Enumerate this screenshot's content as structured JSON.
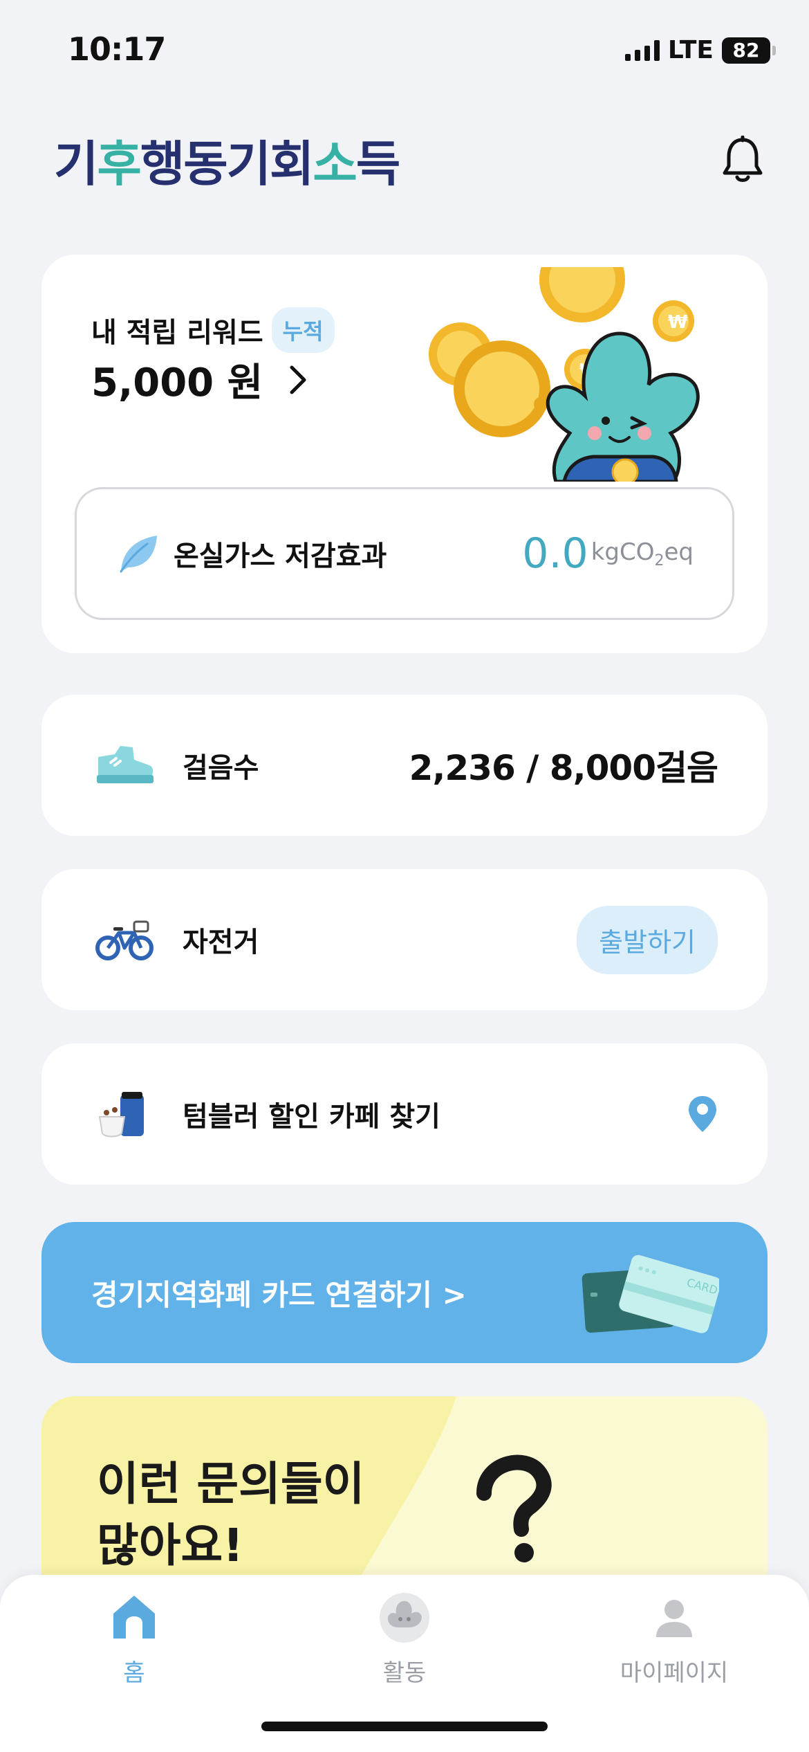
{
  "status_bar": {
    "time": "10:17",
    "network": "LTE",
    "battery": "82"
  },
  "header": {
    "logo_parts": [
      "기",
      "후",
      "행동기회",
      "소",
      "득"
    ]
  },
  "reward": {
    "label": "내 적립 리워드",
    "badge": "누적",
    "amount": "5,000 원",
    "ghg_label": "온실가스 저감효과",
    "ghg_value": "0.0",
    "ghg_unit_pre": "kgCO",
    "ghg_unit_sub": "2",
    "ghg_unit_post": "eq"
  },
  "steps": {
    "label": "걸음수",
    "value": "2,236 / 8,000걸음"
  },
  "bike": {
    "label": "자전거",
    "button": "출발하기"
  },
  "tumbler": {
    "label": "텀블러 할인 카페 찾기"
  },
  "banner": {
    "text": "경기지역화폐 카드 연결하기 >",
    "card_text": "CARD"
  },
  "faq": {
    "title": "이런 문의들이\n많아요!"
  },
  "tabbar": {
    "tabs": [
      {
        "label": "홈",
        "active": true
      },
      {
        "label": "활동",
        "active": false
      },
      {
        "label": "마이페이지",
        "active": false
      }
    ]
  },
  "colors": {
    "accent": "#5aa9df",
    "brand": "#27306f",
    "banner": "#62b2ea",
    "teal": "#43a9c0"
  }
}
